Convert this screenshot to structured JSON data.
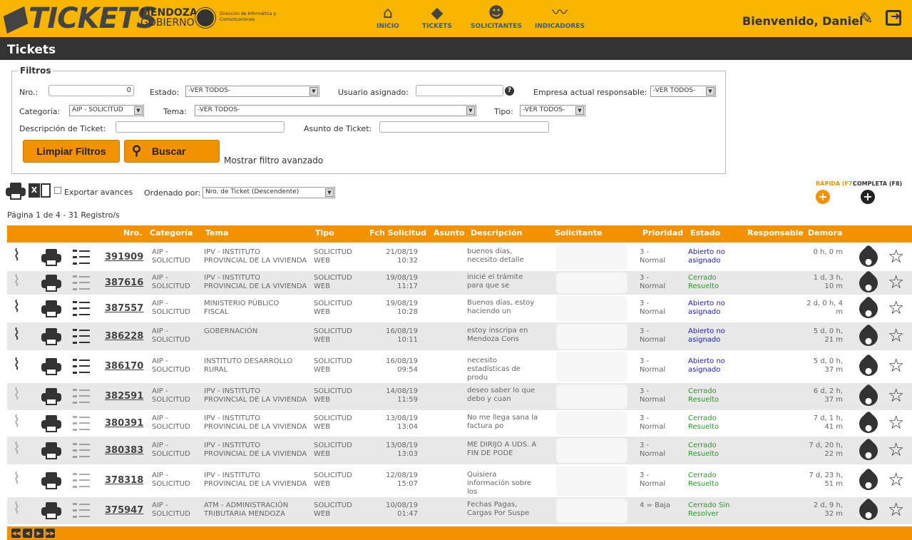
{
  "header": {
    "logo_text": "TICKETS",
    "gobierno_line1": "MENDOZA",
    "gobierno_line2": "GOBIERNO",
    "direccion": "Dirección de Informática y Comunicaciones",
    "nav": [
      {
        "label": "INICIO",
        "icon": "home-icon"
      },
      {
        "label": "TICKETS",
        "icon": "ticket-icon"
      },
      {
        "label": "SOLICITANTES",
        "icon": "people-icon"
      },
      {
        "label": "INDICADORES",
        "icon": "chart-icon"
      }
    ],
    "welcome": "Bienvenido, Daniel"
  },
  "page_title": "Tickets",
  "filters": {
    "legend": "Filtros",
    "nro_label": "Nro.:",
    "nro_value": "0",
    "estado_label": "Estado:",
    "estado_value": "-VER TODOS-",
    "usuario_label": "Usuario asignado:",
    "usuario_value": "",
    "empresa_label": "Empresa actual responsable:",
    "empresa_value": "-VER TODOS-",
    "categoria_label": "Categoría:",
    "categoria_value": "AIP - SOLICITUD",
    "tema_label": "Tema:",
    "tema_value": "-VER TODOS-",
    "tipo_label": "Tipo:",
    "tipo_value": "-VER TODOS-",
    "descripcion_label": "Descripción de Ticket:",
    "descripcion_value": "",
    "asunto_label": "Asunto de Ticket:",
    "asunto_value": "",
    "limpiar_label": "Limpiar Filtros",
    "buscar_label": "Buscar",
    "avanzado_label": "Mostrar filtro avanzado"
  },
  "toolbar": {
    "exportar_label": "Exportar avances",
    "ordenado_label": "Ordenado por:",
    "ordenado_value": "Nro. de Ticket (Descendente)",
    "pagina_info": "Página 1 de 4 - 31 Registro/s",
    "rapida_label": "RÁPIDA (F7)",
    "completa_label": "COMPLETA (F8)"
  },
  "table": {
    "headers": [
      "Nro.",
      "Categoría",
      "Tema",
      "Tipo",
      "Fch Solicitud",
      "Asunto",
      "Descripción",
      "Solicitante",
      "Prioridad",
      "Estado",
      "Responsable",
      "Demora"
    ],
    "rows": [
      {
        "nro": "391909",
        "cat1": "AIP -",
        "cat2": "SOLICITUD",
        "tema1": "IPV - INSTITUTO",
        "tema2": "PROVINCIAL DE LA VIVIENDA",
        "tipo1": "SOLICITUD",
        "tipo2": "WEB",
        "fecha1": "21/08/19",
        "fecha2": "10:32",
        "desc1": "buenos días,",
        "desc2": "necesito detalle",
        "desc3": "",
        "prio1": "3 -",
        "prio2": "Normal",
        "est1": "Abierto no",
        "est2": "asignado",
        "est_color": "#1a1acc",
        "dem1": "0 h, 0 m",
        "dem2": "",
        "light": false
      },
      {
        "nro": "387616",
        "cat1": "AIP -",
        "cat2": "SOLICITUD",
        "tema1": "IPV - INSTITUTO",
        "tema2": "PROVINCIAL DE LA VIVIENDA",
        "tipo1": "SOLICITUD",
        "tipo2": "WEB",
        "fecha1": "19/08/19",
        "fecha2": "11:17",
        "desc1": "inicié el trámite",
        "desc2": "para que se",
        "desc3": "",
        "prio1": "3 -",
        "prio2": "Normal",
        "est1": "Cerrado",
        "est2": "Resuelto",
        "est_color": "#2a9a2a",
        "dem1": "1 d, 3 h,",
        "dem2": "10 m",
        "light": true
      },
      {
        "nro": "387557",
        "cat1": "AIP -",
        "cat2": "SOLICITUD",
        "tema1": "MINISTERIO PÚBLICO",
        "tema2": "FISCAL",
        "tipo1": "SOLICITUD",
        "tipo2": "WEB",
        "fecha1": "19/08/19",
        "fecha2": "10:28",
        "desc1": "Buenos días, estoy",
        "desc2": "haciendo un",
        "desc3": "",
        "prio1": "3 -",
        "prio2": "Normal",
        "est1": "Abierto no",
        "est2": "asignado",
        "est_color": "#1a1acc",
        "dem1": "2 d, 0 h, 4",
        "dem2": "m",
        "light": false
      },
      {
        "nro": "386228",
        "cat1": "AIP -",
        "cat2": "SOLICITUD",
        "tema1": "GOBERNACIÓN",
        "tema2": "",
        "tipo1": "SOLICITUD",
        "tipo2": "WEB",
        "fecha1": "16/08/19",
        "fecha2": "10:11",
        "desc1": "estoy inscripa en",
        "desc2": "Mendoza Cons",
        "desc3": "",
        "prio1": "3 -",
        "prio2": "Normal",
        "est1": "Abierto no",
        "est2": "asignado",
        "est_color": "#1a1acc",
        "dem1": "5 d, 0 h,",
        "dem2": "21 m",
        "light": false
      },
      {
        "nro": "386170",
        "cat1": "AIP -",
        "cat2": "SOLICITUD",
        "tema1": "INSTITUTO DESARROLLO",
        "tema2": "RURAL",
        "tipo1": "SOLICITUD",
        "tipo2": "WEB",
        "fecha1": "16/08/19",
        "fecha2": "09:54",
        "desc1": "necesito",
        "desc2": "estadísticas de",
        "desc3": "produ",
        "prio1": "3 -",
        "prio2": "Normal",
        "est1": "Abierto no",
        "est2": "asignado",
        "est_color": "#1a1acc",
        "dem1": "5 d, 0 h,",
        "dem2": "37 m",
        "light": false
      },
      {
        "nro": "382591",
        "cat1": "AIP -",
        "cat2": "SOLICITUD",
        "tema1": "IPV - INSTITUTO",
        "tema2": "PROVINCIAL DE LA VIVIENDA",
        "tipo1": "SOLICITUD",
        "tipo2": "WEB",
        "fecha1": "14/08/19",
        "fecha2": "11:59",
        "desc1": "deseo saber lo que",
        "desc2": "debo y cuan",
        "desc3": "",
        "prio1": "3 -",
        "prio2": "Normal",
        "est1": "Cerrado",
        "est2": "Resuelto",
        "est_color": "#2a9a2a",
        "dem1": "6 d, 2 h,",
        "dem2": "37 m",
        "light": true
      },
      {
        "nro": "380391",
        "cat1": "AIP -",
        "cat2": "SOLICITUD",
        "tema1": "IPV - INSTITUTO",
        "tema2": "PROVINCIAL DE LA VIVIENDA",
        "tipo1": "SOLICITUD",
        "tipo2": "WEB",
        "fecha1": "13/08/19",
        "fecha2": "13:04",
        "desc1": "No me llega sana la",
        "desc2": "factura po",
        "desc3": "",
        "prio1": "3 -",
        "prio2": "Normal",
        "est1": "Cerrado",
        "est2": "Resuelto",
        "est_color": "#2a9a2a",
        "dem1": "7 d, 1 h,",
        "dem2": "41 m",
        "light": true
      },
      {
        "nro": "380383",
        "cat1": "AIP -",
        "cat2": "SOLICITUD",
        "tema1": "IPV - INSTITUTO",
        "tema2": "PROVINCIAL DE LA VIVIENDA",
        "tipo1": "SOLICITUD",
        "tipo2": "WEB",
        "fecha1": "13/08/19",
        "fecha2": "13:03",
        "desc1": "ME DIRIJO A UDS. A",
        "desc2": "FIN DE PODE",
        "desc3": "",
        "prio1": "3 -",
        "prio2": "Normal",
        "est1": "Cerrado",
        "est2": "Resuelto",
        "est_color": "#2a9a2a",
        "dem1": "7 d, 20 h,",
        "dem2": "22 m",
        "light": true
      },
      {
        "nro": "378318",
        "cat1": "AIP -",
        "cat2": "SOLICITUD",
        "tema1": "IPV - INSTITUTO",
        "tema2": "PROVINCIAL DE LA VIVIENDA",
        "tipo1": "SOLICITUD",
        "tipo2": "WEB",
        "fecha1": "12/08/19",
        "fecha2": "15:07",
        "desc1": "Quisiera",
        "desc2": "información sobre",
        "desc3": "los",
        "prio1": "3 -",
        "prio2": "Normal",
        "est1": "Cerrado",
        "est2": "Resuelto",
        "est_color": "#2a9a2a",
        "dem1": "7 d, 23 h,",
        "dem2": "51 m",
        "light": true
      },
      {
        "nro": "375947",
        "cat1": "AIP -",
        "cat2": "SOLICITUD",
        "tema1": "ATM - ADMINISTRACIÓN",
        "tema2": "TRIBUTARIA MENDOZA",
        "tipo1": "SOLICITUD",
        "tipo2": "WEB",
        "fecha1": "10/08/19",
        "fecha2": "01:47",
        "desc1": "Fechas Pagas,",
        "desc2": "Cargas Por Suspe",
        "desc3": "",
        "prio1": "4 = Baja",
        "prio2": "",
        "est1": "Cerrado Sin",
        "est2": "Resolver",
        "est_color": "#2a9a2a",
        "dem1": "2 d, 9 h,",
        "dem2": "32 m",
        "light": true
      }
    ]
  },
  "colors": {
    "accent": "#f39200",
    "topbar": "#f7b500",
    "dark": "#333333"
  }
}
